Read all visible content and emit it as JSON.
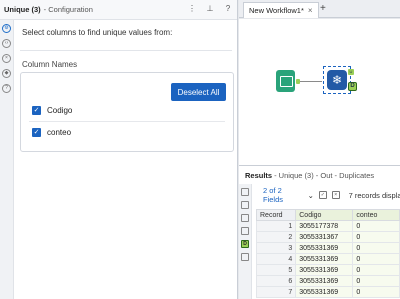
{
  "config": {
    "title": "Unique (3)",
    "subtitle": " - Configuration",
    "header_icons": [
      "more-icon",
      "pin-icon",
      "help-icon"
    ],
    "instruction": "Select columns to find unique values from:",
    "columns_label": "Column Names",
    "deselect_label": "Deselect All",
    "columns": [
      {
        "name": "Codigo",
        "checked": true
      },
      {
        "name": "conteo",
        "checked": true
      }
    ]
  },
  "workflow": {
    "tab_title": "New Workflow1*",
    "tab_close": "×",
    "add_tab": "+",
    "unique_anchor_top": "U",
    "unique_anchor_bottom": "D"
  },
  "results": {
    "title": "Results",
    "subtitle": " - Unique (3) - Out - Duplicates",
    "fields_selector": "2 of 2 Fields",
    "record_count": "7 records displa",
    "columns": [
      "Record",
      "Codigo",
      "conteo"
    ],
    "rows": [
      [
        "1",
        "3055177378",
        "0"
      ],
      [
        "2",
        "3055331367",
        "0"
      ],
      [
        "3",
        "3055331369",
        "0"
      ],
      [
        "4",
        "3055331369",
        "0"
      ],
      [
        "5",
        "3055331369",
        "0"
      ],
      [
        "6",
        "3055331369",
        "0"
      ],
      [
        "7",
        "3055331369",
        "0"
      ]
    ]
  },
  "colors": {
    "accent": "#1b63c0",
    "input_tool": "#2aa37a",
    "unique_tool": "#235aa6",
    "anchor": "#9bcf58"
  }
}
